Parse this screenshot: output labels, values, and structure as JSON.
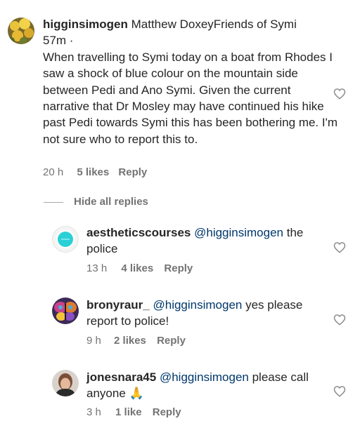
{
  "comment": {
    "username": "higginsimogen",
    "header_text": " Matthew DoxeyFriends of Symi",
    "time_posted": "57m ·",
    "body": "When travelling to Symi today on a boat from Rhodes I saw a shock of blue colour on the mountain side between Pedi and Ano Symi. Given the current narrative that Dr Mosley may have continued his hike past Pedi towards Symi this has been bothering me. I'm not sure who to report this to.",
    "age": "20 h",
    "likes": "5 likes",
    "reply": "Reply",
    "avatar_icon": "yellow-flowers-avatar"
  },
  "hide_replies_label": "Hide all replies",
  "replies": [
    {
      "username": "aestheticscourses",
      "mention": "@higginsimogen",
      "text": " the police",
      "age": "13 h",
      "likes": "4 likes",
      "reply": "Reply",
      "avatar_icon": "teal-circle-avatar"
    },
    {
      "username": "bronyraur_",
      "mention": "@higginsimogen",
      "text": " yes please report to police!",
      "age": "9 h",
      "likes": "2 likes",
      "reply": "Reply",
      "avatar_icon": "butterfly-avatar"
    },
    {
      "username": "jonesnara45",
      "mention": "@higginsimogen",
      "text": " please call anyone 🙏",
      "age": "3 h",
      "likes": "1 like",
      "reply": "Reply",
      "avatar_icon": "person-photo-avatar"
    }
  ],
  "colors": {
    "text": "#262626",
    "secondary": "#737373",
    "mention": "#00376b",
    "heart_stroke": "#8e8e8e"
  }
}
